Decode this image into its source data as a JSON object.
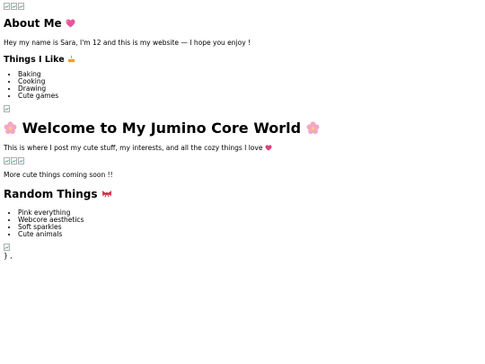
{
  "about": {
    "heading": "About Me",
    "heading_icon": "pink-heart-icon",
    "intro": "Hey my name is Sara, I'm 12 and this is my website — I hope you enjoy !"
  },
  "likes": {
    "heading": "Things I Like",
    "heading_icon": "cake-icon",
    "items": [
      "Baking",
      "Cooking",
      "Drawing",
      "Cute games"
    ]
  },
  "welcome": {
    "heading": "Welcome to My Jumino Core World",
    "heading_icon": "cherry-blossom-icon",
    "text": "This is where I post my cute stuff, my interests, and all the cozy things I love",
    "text_icon": "heart-icon"
  },
  "coming_soon": {
    "text": "More cute things coming soon !!"
  },
  "random": {
    "heading": "Random Things",
    "heading_icon": "ribbon-icon",
    "items": [
      "Pink everything",
      "Webcore aesthetics",
      "Soft sparkles",
      "Cute animals"
    ]
  },
  "stray_text": "} ,",
  "colors": {
    "heart_pink": "#e8559a",
    "blossom_pink": "#f4a6c6",
    "ribbon_red": "#e0304a",
    "cake_orange": "#f0a030"
  }
}
